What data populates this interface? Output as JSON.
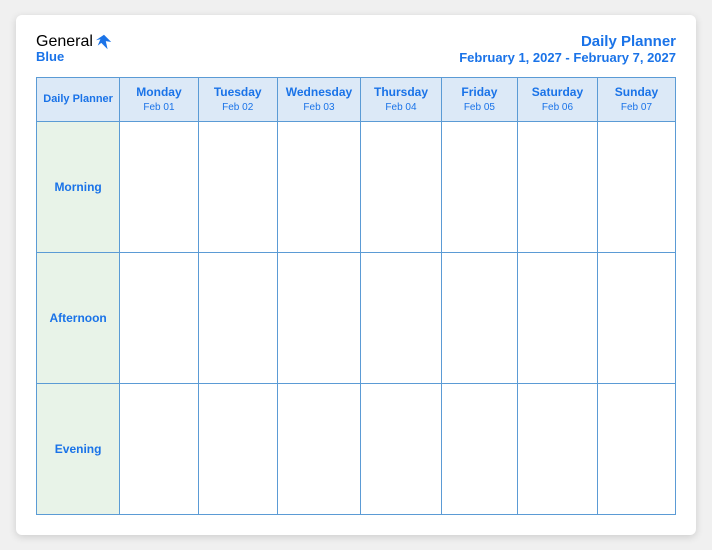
{
  "logo": {
    "general": "General",
    "blue": "Blue"
  },
  "header": {
    "title": "Daily Planner",
    "date_range": "February 1, 2027 - February 7, 2027"
  },
  "table": {
    "col_header_label": "Daily Planner",
    "columns": [
      {
        "day": "Monday",
        "date": "Feb 01"
      },
      {
        "day": "Tuesday",
        "date": "Feb 02"
      },
      {
        "day": "Wednesday",
        "date": "Feb 03"
      },
      {
        "day": "Thursday",
        "date": "Feb 04"
      },
      {
        "day": "Friday",
        "date": "Feb 05"
      },
      {
        "day": "Saturday",
        "date": "Feb 06"
      },
      {
        "day": "Sunday",
        "date": "Feb 07"
      }
    ],
    "rows": [
      {
        "label": "Morning"
      },
      {
        "label": "Afternoon"
      },
      {
        "label": "Evening"
      }
    ]
  }
}
